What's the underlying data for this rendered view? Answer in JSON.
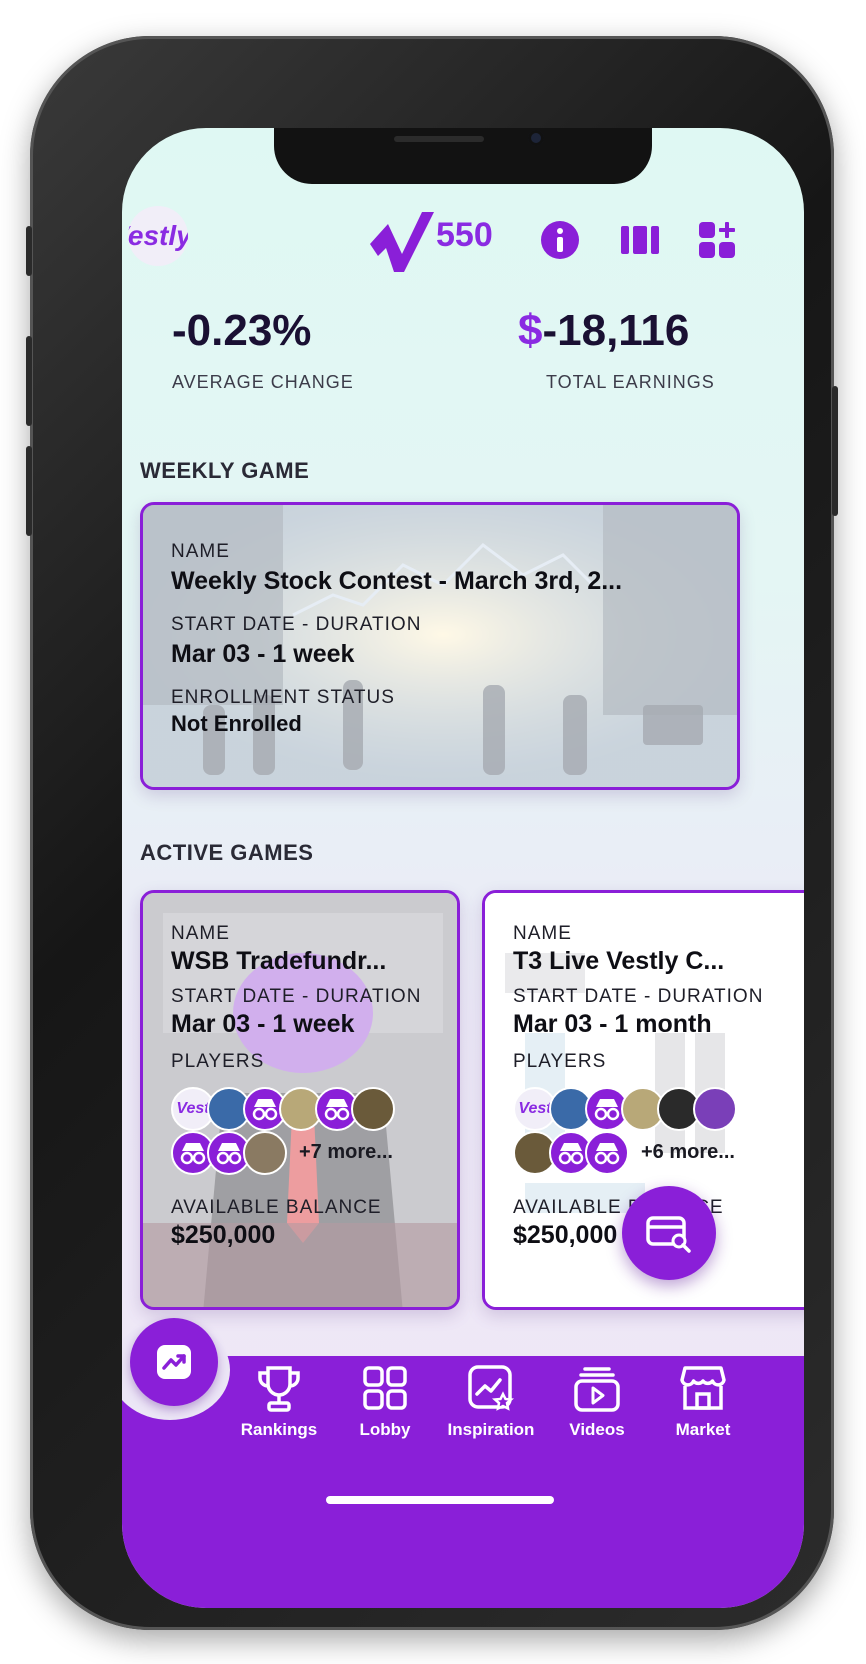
{
  "header": {
    "logo_text": "Vestly",
    "score": "550"
  },
  "stats": {
    "average_change_value": "-0.23%",
    "average_change_label": "AVERAGE CHANGE",
    "earnings_currency": "$",
    "earnings_value": "-18,116",
    "earnings_label": "TOTAL EARNINGS"
  },
  "weekly": {
    "section_title": "WEEKLY GAME",
    "name_label": "NAME",
    "name": "Weekly Stock Contest - March 3rd, 2...",
    "start_label": "START DATE - DURATION",
    "start": "Mar 03 - 1 week",
    "status_label": "ENROLLMENT STATUS",
    "status": "Not Enrolled"
  },
  "active": {
    "section_title": "ACTIVE GAMES",
    "games": [
      {
        "name_label": "NAME",
        "name": "WSB Tradefundr...",
        "start_label": "START DATE - DURATION",
        "start": "Mar 03 - 1 week",
        "players_label": "PLAYERS",
        "more": "+7 more...",
        "balance_label": "AVAILABLE BALANCE",
        "balance": "$250,000"
      },
      {
        "name_label": "NAME",
        "name": "T3 Live Vestly C...",
        "start_label": "START DATE - DURATION",
        "start": "Mar 03 - 1 month",
        "players_label": "PLAYERS",
        "more": "+6 more...",
        "balance_label": "AVAILABLE BALANCE",
        "balance": "$250,000"
      }
    ]
  },
  "nav": {
    "partial_label": "R",
    "items": [
      "Rankings",
      "Lobby",
      "Inspiration",
      "Videos",
      "Market"
    ]
  },
  "colors": {
    "accent": "#8a1fd8",
    "text": "#1a1033"
  }
}
